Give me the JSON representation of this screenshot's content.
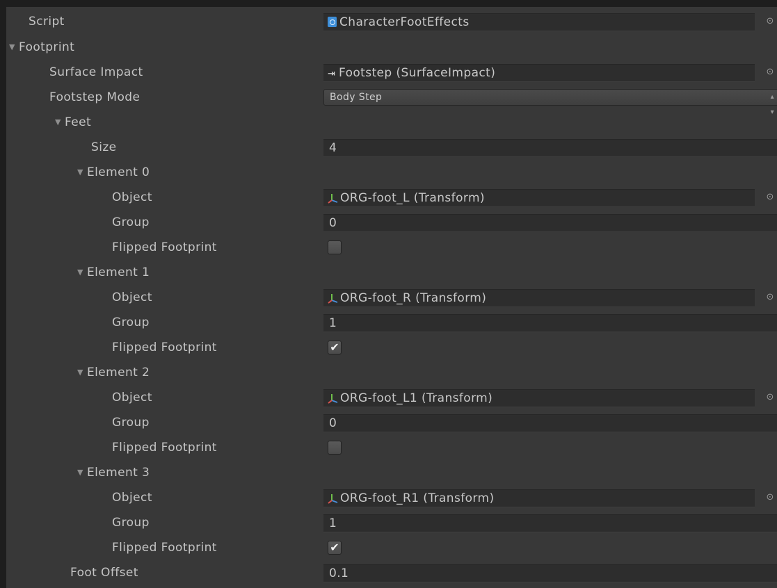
{
  "script": {
    "label": "Script",
    "value": "CharacterFootEffects"
  },
  "footprint": {
    "label": "Footprint",
    "surface_impact": {
      "label": "Surface Impact",
      "value": "Footstep (SurfaceImpact)"
    },
    "footstep_mode": {
      "label": "Footstep Mode",
      "value": "Body Step"
    },
    "feet": {
      "label": "Feet",
      "size": {
        "label": "Size",
        "value": "4"
      },
      "elements": [
        {
          "label": "Element 0",
          "object_label": "Object",
          "object_value": "ORG-foot_L (Transform)",
          "group_label": "Group",
          "group_value": "0",
          "flipped_label": "Flipped Footprint",
          "flipped_checked": false,
          "flipped_mark": ""
        },
        {
          "label": "Element 1",
          "object_label": "Object",
          "object_value": "ORG-foot_R (Transform)",
          "group_label": "Group",
          "group_value": "1",
          "flipped_label": "Flipped Footprint",
          "flipped_checked": true,
          "flipped_mark": "✔"
        },
        {
          "label": "Element 2",
          "object_label": "Object",
          "object_value": "ORG-foot_L1 (Transform)",
          "group_label": "Group",
          "group_value": "0",
          "flipped_label": "Flipped Footprint",
          "flipped_checked": false,
          "flipped_mark": ""
        },
        {
          "label": "Element 3",
          "object_label": "Object",
          "object_value": "ORG-foot_R1 (Transform)",
          "group_label": "Group",
          "group_value": "1",
          "flipped_label": "Flipped Footprint",
          "flipped_checked": true,
          "flipped_mark": "✔"
        }
      ]
    },
    "foot_offset": {
      "label": "Foot Offset",
      "value": "0.1"
    }
  },
  "icons": {
    "script": "script-file-icon",
    "surface_impact": "surface-impact-icon",
    "transform": "transform-axes-icon",
    "object_picker": "object-picker-icon",
    "foldout": "foldout-arrow-icon",
    "dropdown": "dropdown-spinner-icon"
  },
  "colors": {
    "background": "#383838",
    "field": "#2d2d2d",
    "text": "#c4c4c4",
    "script_icon": "#3d8ed8",
    "axis_red": "#d9534f",
    "axis_green": "#6fbf4a",
    "axis_blue": "#4a8fd9"
  }
}
